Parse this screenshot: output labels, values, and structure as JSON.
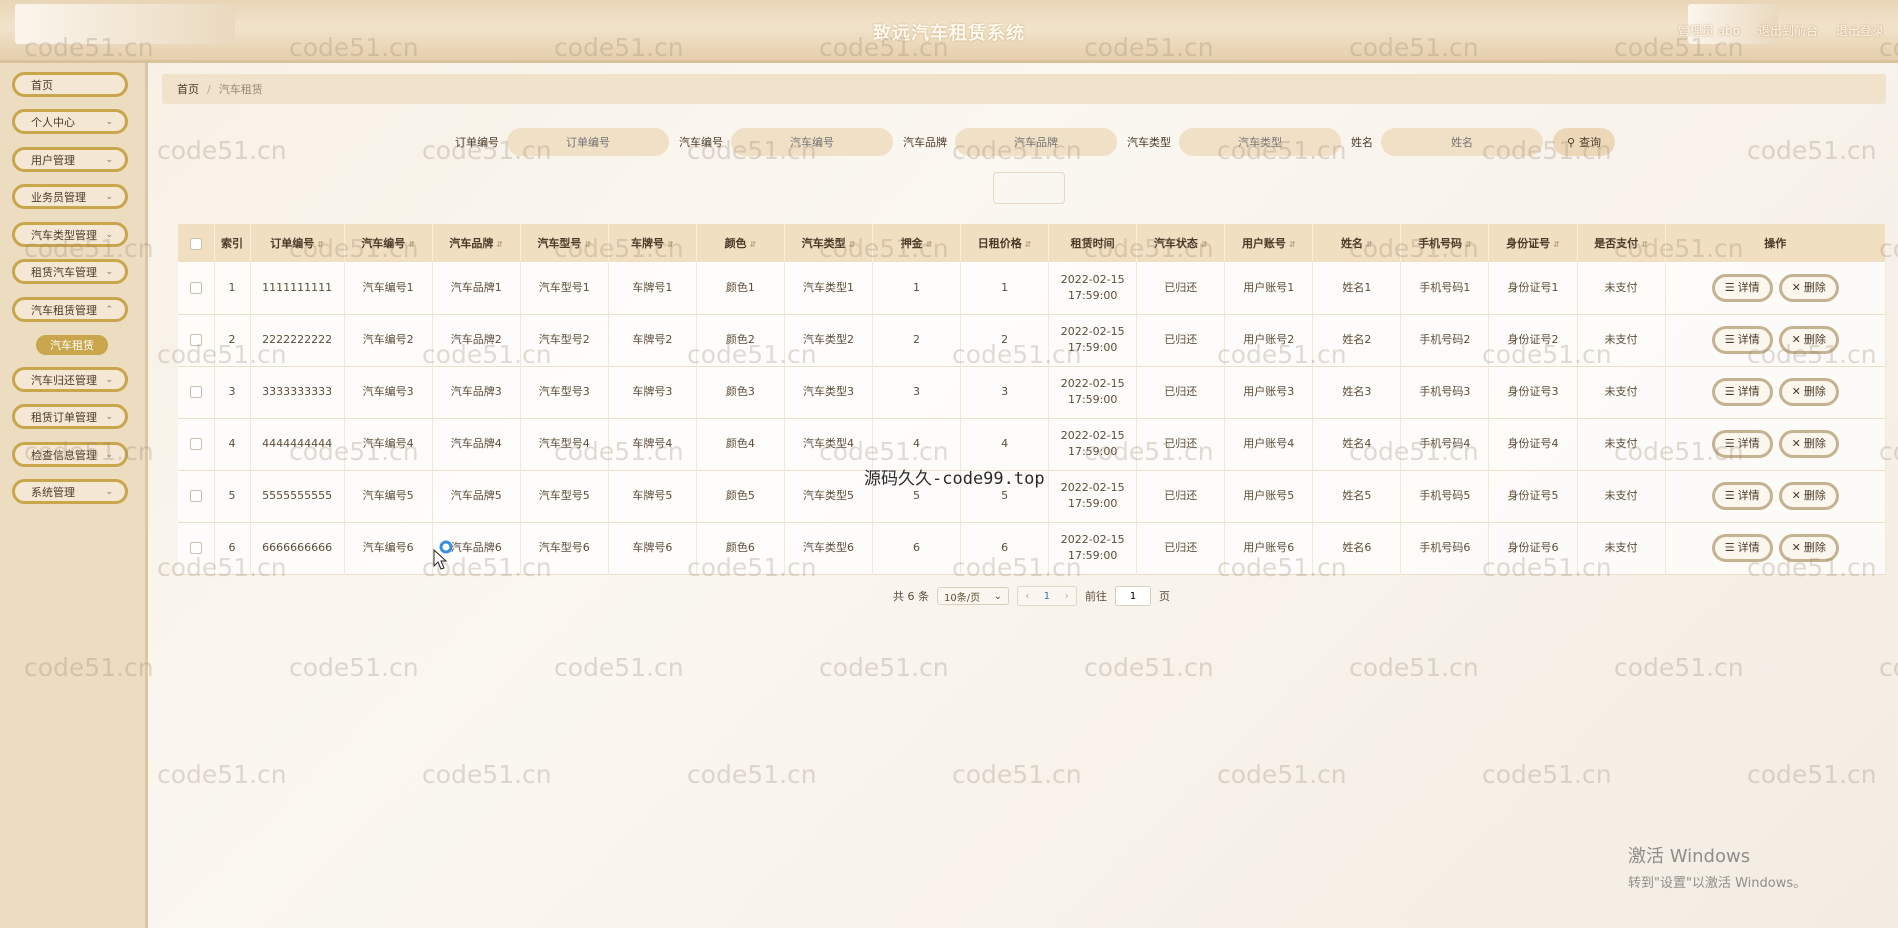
{
  "header": {
    "title": "致远汽车租赁系统",
    "admin_label": "管理员 abo",
    "back_link": "退出到前台",
    "logout_link": "退出登录"
  },
  "sidebar": {
    "items": [
      {
        "label": "首页",
        "expandable": false
      },
      {
        "label": "个人中心",
        "expandable": true
      },
      {
        "label": "用户管理",
        "expandable": true
      },
      {
        "label": "业务员管理",
        "expandable": true
      },
      {
        "label": "汽车类型管理",
        "expandable": true
      },
      {
        "label": "租赁汽车管理",
        "expandable": true
      },
      {
        "label": "汽车租赁管理",
        "expandable": true
      },
      {
        "label": "汽车归还管理",
        "expandable": true
      },
      {
        "label": "租赁订单管理",
        "expandable": true
      },
      {
        "label": "检查信息管理",
        "expandable": true
      },
      {
        "label": "系统管理",
        "expandable": true
      }
    ],
    "active_sub": "汽车租赁"
  },
  "breadcrumb": {
    "home": "首页",
    "current": "汽车租赁"
  },
  "search": {
    "fields": [
      {
        "label": "订单编号",
        "placeholder": "订单编号"
      },
      {
        "label": "汽车编号",
        "placeholder": "汽车编号"
      },
      {
        "label": "汽车品牌",
        "placeholder": "汽车品牌"
      },
      {
        "label": "汽车类型",
        "placeholder": "汽车类型"
      },
      {
        "label": "姓名",
        "placeholder": "姓名"
      }
    ],
    "button": "查询"
  },
  "table": {
    "columns": [
      "索引",
      "订单编号",
      "汽车编号",
      "汽车品牌",
      "汽车型号",
      "车牌号",
      "颜色",
      "汽车类型",
      "押金",
      "日租价格",
      "租赁时间",
      "汽车状态",
      "用户账号",
      "姓名",
      "手机号码",
      "身份证号",
      "是否支付",
      "操作"
    ],
    "rows": [
      [
        "1",
        "1111111111",
        "汽车编号1",
        "汽车品牌1",
        "汽车型号1",
        "车牌号1",
        "颜色1",
        "汽车类型1",
        "1",
        "1",
        "2022-02-15 17:59:00",
        "已归还",
        "用户账号1",
        "姓名1",
        "手机号码1",
        "身份证号1",
        "未支付"
      ],
      [
        "2",
        "2222222222",
        "汽车编号2",
        "汽车品牌2",
        "汽车型号2",
        "车牌号2",
        "颜色2",
        "汽车类型2",
        "2",
        "2",
        "2022-02-15 17:59:00",
        "已归还",
        "用户账号2",
        "姓名2",
        "手机号码2",
        "身份证号2",
        "未支付"
      ],
      [
        "3",
        "3333333333",
        "汽车编号3",
        "汽车品牌3",
        "汽车型号3",
        "车牌号3",
        "颜色3",
        "汽车类型3",
        "3",
        "3",
        "2022-02-15 17:59:00",
        "已归还",
        "用户账号3",
        "姓名3",
        "手机号码3",
        "身份证号3",
        "未支付"
      ],
      [
        "4",
        "4444444444",
        "汽车编号4",
        "汽车品牌4",
        "汽车型号4",
        "车牌号4",
        "颜色4",
        "汽车类型4",
        "4",
        "4",
        "2022-02-15 17:59:00",
        "已归还",
        "用户账号4",
        "姓名4",
        "手机号码4",
        "身份证号4",
        "未支付"
      ],
      [
        "5",
        "5555555555",
        "汽车编号5",
        "汽车品牌5",
        "汽车型号5",
        "车牌号5",
        "颜色5",
        "汽车类型5",
        "5",
        "5",
        "2022-02-15 17:59:00",
        "已归还",
        "用户账号5",
        "姓名5",
        "手机号码5",
        "身份证号5",
        "未支付"
      ],
      [
        "6",
        "6666666666",
        "汽车编号6",
        "汽车品牌6",
        "汽车型号6",
        "车牌号6",
        "颜色6",
        "汽车类型6",
        "6",
        "6",
        "2022-02-15 17:59:00",
        "已归还",
        "用户账号6",
        "姓名6",
        "手机号码6",
        "身份证号6",
        "未支付"
      ]
    ],
    "detail_label": "详情",
    "delete_label": "删除"
  },
  "pagination": {
    "total": "共 6 条",
    "page_size": "10条/页",
    "current_page": "1",
    "goto_prefix": "前往",
    "goto_value": "1",
    "goto_suffix": "页"
  },
  "watermark": {
    "text": "code51.cn"
  },
  "source_note": "源码久久-code99.top",
  "windows_activation": {
    "title": "激活 Windows",
    "subtitle": "转到\"设置\"以激活 Windows。"
  },
  "colors": {
    "accent": "#c9a54c",
    "header_bg": "#e8d5b6",
    "sidebar_bg": "#ecdcc0",
    "table_header_bg": "#f1dfc1"
  }
}
